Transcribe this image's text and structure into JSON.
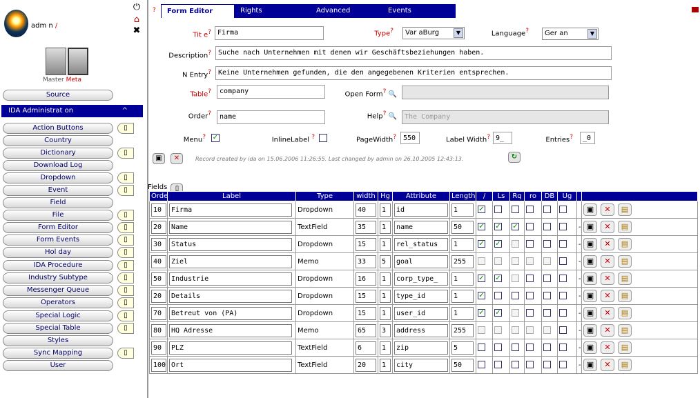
{
  "user": {
    "name": "adm n",
    "name_mark": "/"
  },
  "top_icons": [
    "power-icon",
    "hotel-icon",
    "tools-icon"
  ],
  "servers": {
    "label_1": "Master",
    "label_2": "Meta"
  },
  "sidebar": {
    "source": "Source",
    "active": {
      "label": "IDA Administrat on",
      "caret": "^"
    },
    "items": [
      {
        "label": "Action Buttons",
        "icon": true
      },
      {
        "label": "Country",
        "icon": false
      },
      {
        "label": "Dictionary",
        "icon": true
      },
      {
        "label": "Download Log",
        "icon": false
      },
      {
        "label": "Dropdown",
        "icon": true
      },
      {
        "label": "Event",
        "icon": true
      },
      {
        "label": "Field",
        "icon": false
      },
      {
        "label": "File",
        "icon": true
      },
      {
        "label": "Form Editor",
        "icon": true
      },
      {
        "label": "Form Events",
        "icon": true
      },
      {
        "label": "Hol day",
        "icon": true
      },
      {
        "label": "IDA Procedure",
        "icon": true
      },
      {
        "label": "Industry Subtype",
        "icon": true
      },
      {
        "label": "Messenger Queue",
        "icon": true
      },
      {
        "label": "Operators",
        "icon": true
      },
      {
        "label": "Special Logic",
        "icon": true
      },
      {
        "label": "Special Table",
        "icon": true
      },
      {
        "label": "Styles",
        "icon": false
      },
      {
        "label": "Sync Mapping",
        "icon": true
      },
      {
        "label": "User",
        "icon": false
      }
    ]
  },
  "tabs": {
    "q": "?",
    "items": [
      "Form Editor",
      "Rights",
      "Advanced",
      "Events"
    ]
  },
  "form": {
    "title_label": "Tit e",
    "title_value": "Firma",
    "type_label": "Type",
    "type_value": "Var aBurg",
    "language_label": "Language",
    "language_value": "Ger an",
    "description_label": "Description",
    "description_value": "Suche nach Unternehmen mit denen wir Geschäftsbeziehungen haben.",
    "no_entry_label": "N  Entry",
    "no_entry_value": "Keine Unternehmen gefunden, die den angegebenen Kriterien entsprechen.",
    "table_label": "Table",
    "table_value": "company",
    "open_form_label": "Open Form",
    "open_form_value": "",
    "order_label": "Order",
    "order_value": "name",
    "help_label": "Help",
    "help_value": "The Company",
    "menu_label": "Menu",
    "inline_label": "InlineLabel",
    "page_width_label": "PageWidth",
    "page_width_value": "550",
    "label_width_label": "Label Width",
    "label_width_value": "9_",
    "entries_label": "Entries",
    "entries_value": "_0",
    "record_info": "Record created by ida on 15.06.2006 11:26:55. Last changed by admin on 26.10.2005 12:43:13."
  },
  "fields_label": "Fields",
  "grid": {
    "headers": [
      "Order",
      "Label",
      "Type",
      "width",
      "Hg",
      "Attribute",
      "Length",
      "/",
      "Ls",
      "Rq",
      "ro",
      "DB",
      "Ug",
      "",
      ""
    ],
    "rows": [
      {
        "order": "10",
        "label": "Firma",
        "type": "Dropdown",
        "width": "40",
        "hg": "1",
        "attr": "id",
        "len": "1",
        "c": [
          1,
          0,
          0,
          0,
          0,
          0
        ],
        "dash": ""
      },
      {
        "order": "20",
        "label": "Name",
        "type": "TextField",
        "width": "35",
        "hg": "1",
        "attr": "name",
        "len": "50",
        "c": [
          1,
          1,
          1,
          0,
          0,
          0
        ],
        "dash": "-"
      },
      {
        "order": "30",
        "label": "Status",
        "type": "Dropdown",
        "width": "15",
        "hg": "1",
        "attr": "rel_status",
        "len": "1",
        "c": [
          1,
          1,
          2,
          0,
          0,
          0
        ],
        "dash": "-"
      },
      {
        "order": "40",
        "label": "Ziel",
        "type": "Memo",
        "width": "33",
        "hg": "5",
        "attr": "goal",
        "len": "255",
        "c": [
          3,
          3,
          2,
          3,
          3,
          0
        ],
        "dash": "-"
      },
      {
        "order": "50",
        "label": "Industrie",
        "type": "Dropdown",
        "width": "16",
        "hg": "1",
        "attr": "corp_type_",
        "len": "1",
        "c": [
          1,
          1,
          2,
          0,
          0,
          0
        ],
        "dash": "-"
      },
      {
        "order": "20",
        "label": "Details",
        "type": "Dropdown",
        "width": "15",
        "hg": "1",
        "attr": "type_id",
        "len": "1",
        "c": [
          1,
          0,
          0,
          0,
          0,
          0
        ],
        "dash": "-"
      },
      {
        "order": "70",
        "label": "Betreut von (PA)",
        "type": "Dropdown",
        "width": "15",
        "hg": "1",
        "attr": "user_id",
        "len": "1",
        "c": [
          1,
          1,
          2,
          0,
          0,
          0
        ],
        "dash": "-"
      },
      {
        "order": "80",
        "label": "HQ Adresse",
        "type": "Memo",
        "width": "65",
        "hg": "3",
        "attr": "address",
        "len": "255",
        "c": [
          3,
          3,
          2,
          3,
          3,
          0
        ],
        "dash": "-"
      },
      {
        "order": "90",
        "label": "PLZ",
        "type": "TextField",
        "width": "6",
        "hg": "1",
        "attr": "zip",
        "len": "5",
        "c": [
          0,
          0,
          0,
          0,
          0,
          0
        ],
        "dash": "-"
      },
      {
        "order": "100",
        "label": "Ort",
        "type": "TextField",
        "width": "20",
        "hg": "1",
        "attr": "city",
        "len": "50",
        "c": [
          0,
          0,
          0,
          0,
          0,
          0
        ],
        "dash": "-"
      }
    ]
  }
}
